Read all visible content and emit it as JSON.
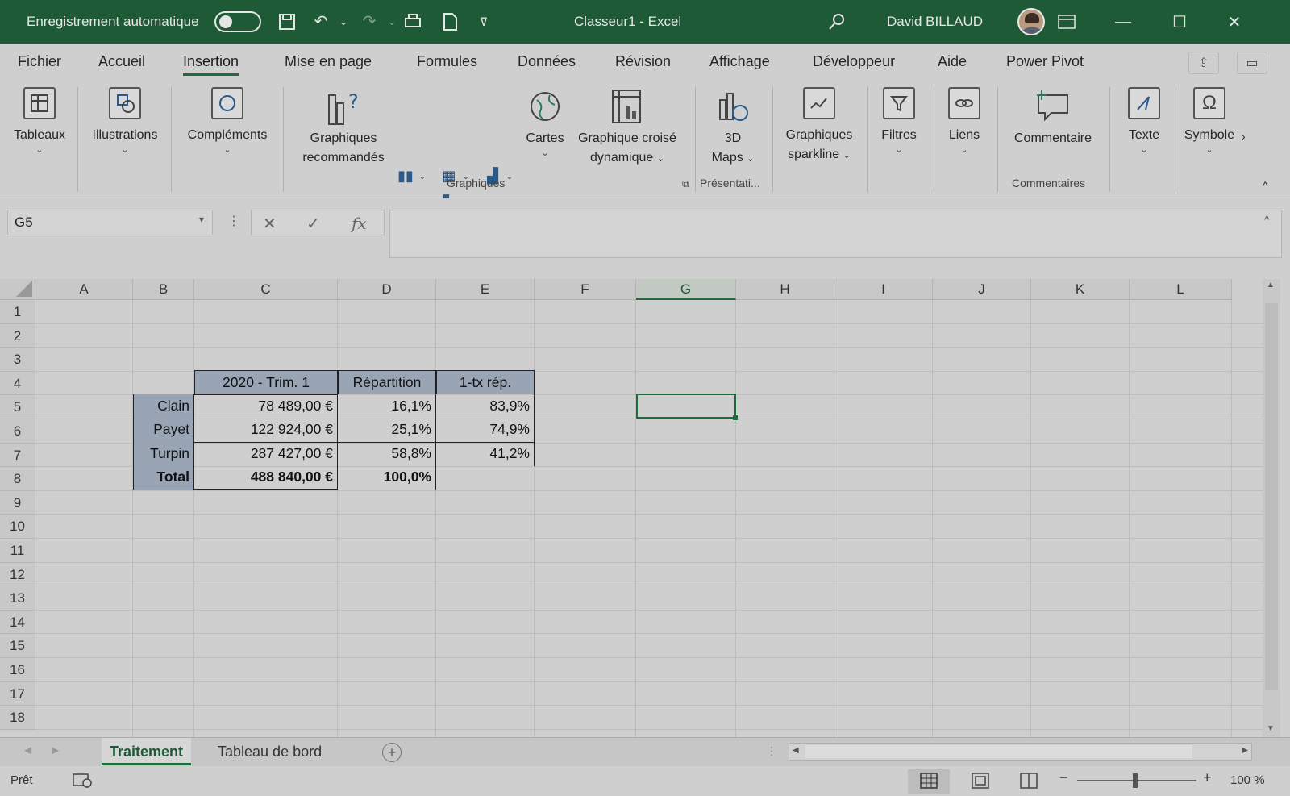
{
  "titlebar": {
    "autosave_label": "Enregistrement automatique",
    "app_title": "Classeur1  -  Excel",
    "user_name": "David BILLAUD",
    "colors": {
      "bar": "#1e5a36",
      "accent": "#1e6b3c"
    }
  },
  "menu": {
    "tabs": [
      "Fichier",
      "Accueil",
      "Insertion",
      "Mise en page",
      "Formules",
      "Données",
      "Révision",
      "Affichage",
      "Développeur",
      "Aide",
      "Power Pivot"
    ],
    "active_tab": "Insertion"
  },
  "ribbon": {
    "tableaux": "Tableaux",
    "illustrations": "Illustrations",
    "complements": "Compléments",
    "graph_reco_1": "Graphiques",
    "graph_reco_2": "recommandés",
    "cartes": "Cartes",
    "croise_1": "Graphique croisé",
    "croise_2": "dynamique",
    "maps_1": "3D",
    "maps_2": "Maps",
    "sparkline_1": "Graphiques",
    "sparkline_2": "sparkline",
    "filtres": "Filtres",
    "liens": "Liens",
    "commentaire": "Commentaire",
    "texte": "Texte",
    "symbole": "Symbole",
    "group_graphiques": "Graphiques",
    "group_presentation": "Présentati...",
    "group_commentaires": "Commentaires"
  },
  "formula_bar": {
    "name_box": "G5",
    "cancel": "✕",
    "confirm": "✓",
    "fx": "fx",
    "value": ""
  },
  "grid": {
    "columns": [
      "A",
      "B",
      "C",
      "D",
      "E",
      "F",
      "G",
      "H",
      "I",
      "J",
      "K",
      "L"
    ],
    "selected_column": "G",
    "rows": [
      "1",
      "2",
      "3",
      "4",
      "5",
      "6",
      "7",
      "8",
      "9",
      "10",
      "11",
      "12",
      "13",
      "14",
      "15",
      "16",
      "17",
      "18"
    ],
    "table": {
      "header_c": "2020 - Trim. 1",
      "header_d": "Répartition",
      "header_e": "1-tx rép.",
      "rows": [
        {
          "name": "Clain",
          "amount": "78 489,00 €",
          "share": "16,1%",
          "inverse": "83,9%"
        },
        {
          "name": "Payet",
          "amount": "122 924,00 €",
          "share": "25,1%",
          "inverse": "74,9%"
        },
        {
          "name": "Turpin",
          "amount": "287 427,00 €",
          "share": "58,8%",
          "inverse": "41,2%"
        }
      ],
      "total": {
        "name": "Total",
        "amount": "488 840,00 €",
        "share": "100,0%"
      }
    }
  },
  "sheets": {
    "tabs": [
      "Traitement",
      "Tableau de bord"
    ],
    "active": "Traitement"
  },
  "status": {
    "ready": "Prêt",
    "zoom": "100 %"
  }
}
